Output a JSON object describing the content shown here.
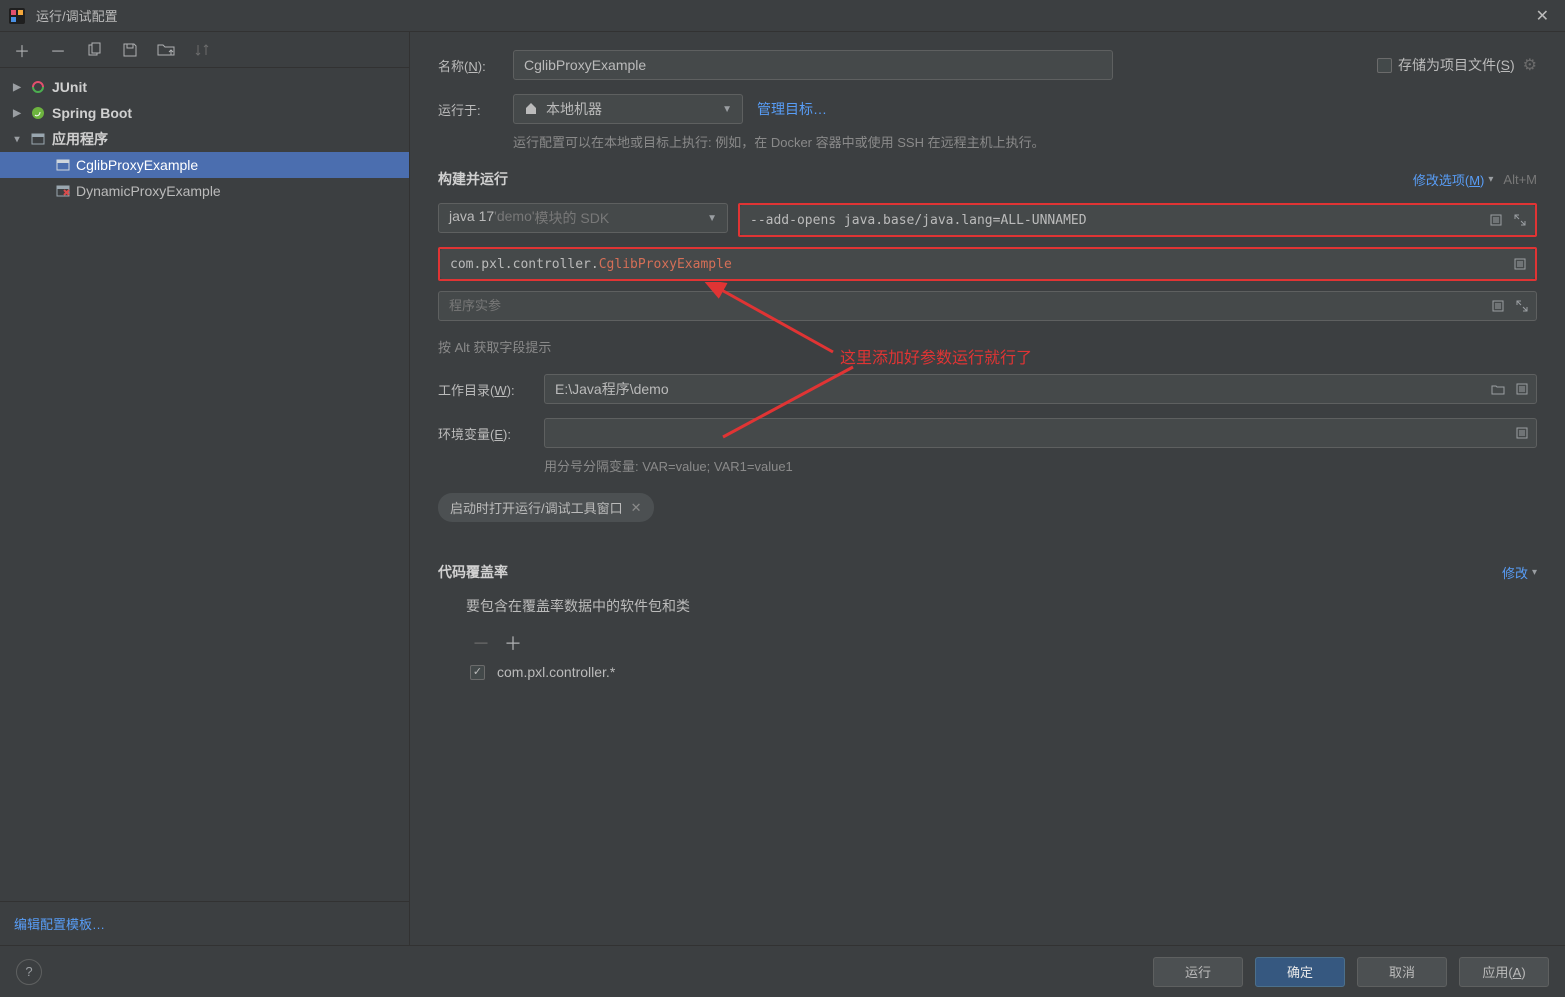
{
  "window": {
    "title": "运行/调试配置"
  },
  "sidebar": {
    "groups": [
      {
        "label": "JUnit",
        "expanded": false
      },
      {
        "label": "Spring Boot",
        "expanded": false
      },
      {
        "label": "应用程序",
        "expanded": true,
        "children": [
          {
            "label": "CglibProxyExample",
            "selected": true,
            "invalid": false
          },
          {
            "label": "DynamicProxyExample",
            "selected": false,
            "invalid": true
          }
        ]
      }
    ],
    "footerLink": "编辑配置模板…"
  },
  "form": {
    "nameLabelPre": "名称(",
    "nameLabelMn": "N",
    "nameLabelPost": "):",
    "nameValue": "CglibProxyExample",
    "storeAsFilePre": "存储为项目文件(",
    "storeAsFileMn": "S",
    "storeAsFilePost": ")",
    "runOnLabel": "运行于:",
    "runOnValue": "本地机器",
    "manageTargets": "管理目标…",
    "runOnHint": "运行配置可以在本地或目标上执行: 例如，在 Docker 容器中或使用 SSH 在远程主机上执行。",
    "buildRunTitle": "构建并运行",
    "modifyOptionsPre": "修改选项(",
    "modifyOptionsMn": "M",
    "modifyOptionsPost": ")",
    "modifyOptionsKbd": "Alt+M",
    "jdkPre": "java 17 ",
    "jdkDemo": "'demo' ",
    "jdkPost": "模块的 SDK",
    "vmOptions": "--add-opens java.base/java.lang=ALL-UNNAMED",
    "mainClassPrefix": "com.pxl.controller.",
    "mainClassName": "CglibProxyExample",
    "programArgsPH": "程序实参",
    "altHint": "按 Alt 获取字段提示",
    "workDirLabelPre": "工作目录(",
    "workDirLabelMn": "W",
    "workDirLabelPost": "):",
    "workDirValue": "E:\\Java程序\\demo",
    "envLabelPre": "环境变量(",
    "envLabelMn": "E",
    "envLabelPost": "):",
    "envHint": "用分号分隔变量: VAR=value; VAR1=value1",
    "pillText": "启动时打开运行/调试工具窗口",
    "coverageTitle": "代码覆盖率",
    "coverageModify": "修改",
    "coverageSubtitle": "要包含在覆盖率数据中的软件包和类",
    "coverageItem": "com.pxl.controller.*"
  },
  "annotation": {
    "text": "这里添加好参数运行就行了"
  },
  "buttons": {
    "run": "运行",
    "ok": "确定",
    "cancel": "取消",
    "applyPre": "应用(",
    "applyMn": "A",
    "applyPost": ")"
  }
}
